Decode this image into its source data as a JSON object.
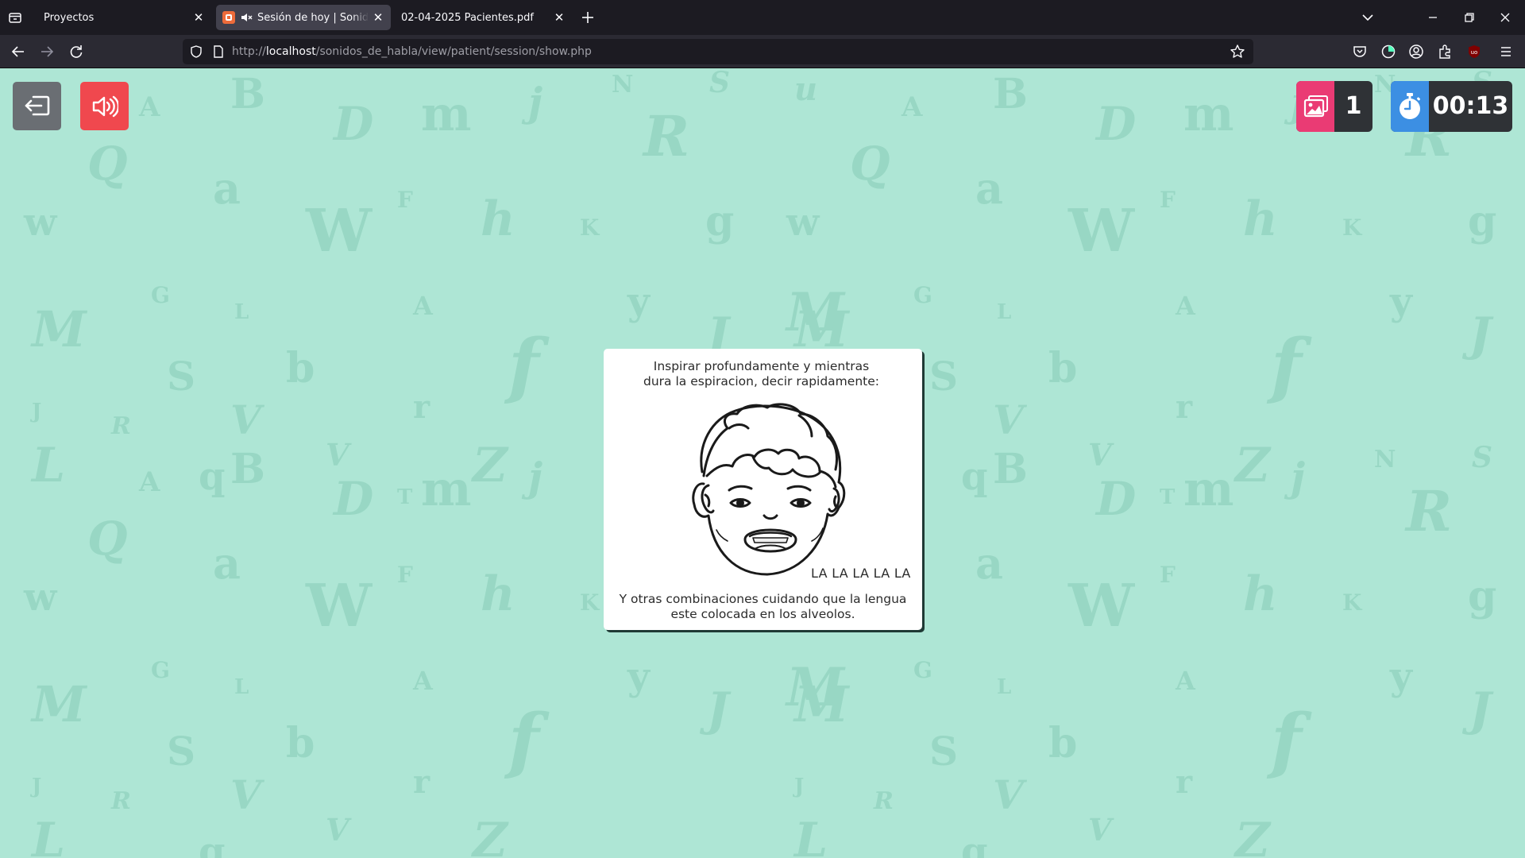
{
  "browser": {
    "tabs": [
      {
        "title": "Proyectos",
        "active": false
      },
      {
        "title": "Sesión de hoy | Sonidos del habla",
        "active": true,
        "muted": true
      },
      {
        "title": "02-04-2025 Pacientes.pdf",
        "active": false
      }
    ],
    "url": {
      "scheme": "http://",
      "host": "localhost",
      "path": "/sonidos_de_habla/view/patient/session/show.php"
    },
    "icons": [
      "list-all-tabs-icon",
      "back-icon",
      "forward-icon",
      "reload-icon",
      "shield-icon",
      "page-icon",
      "star-icon",
      "pocket-icon",
      "sync-icon",
      "account-icon",
      "extensions-icon",
      "ublock-icon",
      "menu-icon"
    ]
  },
  "toolbar": {
    "exit_icon": "exit-icon",
    "sound_icon": "speaker-icon",
    "images_count": "1",
    "timer": "00:13"
  },
  "card": {
    "instruction_line1": "Inspirar profundamente y mientras",
    "instruction_line2": "dura la espiracion, decir rapidamente:",
    "practice_text": "LA LA LA LA LA",
    "footer_line1": "Y otras combinaciones cuidando que la lengua",
    "footer_line2": "este colocada en los alveolos.",
    "illustration": "child-face-open-mouth"
  },
  "colors": {
    "background": "#aee6d5",
    "exit_button": "#6a6e73",
    "sound_button": "#f0484e",
    "images_badge": "#ea3b74",
    "timer_badge": "#3c8fe3"
  }
}
